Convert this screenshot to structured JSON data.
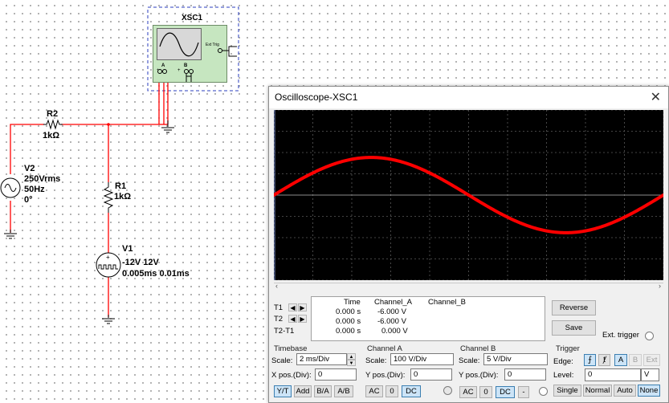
{
  "schematic": {
    "xsc1": {
      "label": "XSC1",
      "ext_trig": "Ext Trig",
      "port_a": "A",
      "port_b": "B",
      "plus": "+",
      "minus": "_"
    },
    "r2": {
      "name": "R2",
      "value": "1kΩ"
    },
    "r1": {
      "name": "R1",
      "value": "1kΩ"
    },
    "v2": {
      "name": "V2",
      "line1": "250Vrms",
      "line2": "50Hz",
      "line3": "0°"
    },
    "v1": {
      "name": "V1",
      "line1": "-12V 12V",
      "line2": "0.005ms 0.01ms"
    }
  },
  "oscilloscope": {
    "title": "Oscilloscope-XSC1",
    "readout": {
      "headers": [
        "Time",
        "Channel_A",
        "Channel_B"
      ],
      "rows": [
        {
          "label": "T1",
          "time": "0.000 s",
          "ch_a": "-6.000 V",
          "ch_b": ""
        },
        {
          "label": "T2",
          "time": "0.000 s",
          "ch_a": "-6.000 V",
          "ch_b": ""
        },
        {
          "label": "T2-T1",
          "time": "0.000 s",
          "ch_a": "0.000 V",
          "ch_b": ""
        }
      ]
    },
    "buttons": {
      "reverse": "Reverse",
      "save": "Save",
      "ext_trigger": "Ext. trigger"
    },
    "timebase": {
      "title": "Timebase",
      "scale_label": "Scale:",
      "scale_value": "2 ms/Div",
      "xpos_label": "X pos.(Div):",
      "xpos_value": "0",
      "modes": [
        "Y/T",
        "Add",
        "B/A",
        "A/B"
      ],
      "active_mode": "Y/T"
    },
    "channel_a": {
      "title": "Channel A",
      "scale_label": "Scale:",
      "scale_value": "100  V/Div",
      "ypos_label": "Y pos.(Div):",
      "ypos_value": "0",
      "coupling": [
        "AC",
        "0",
        "DC"
      ],
      "active_coupling": "DC"
    },
    "channel_b": {
      "title": "Channel B",
      "scale_label": "Scale:",
      "scale_value": "5  V/Div",
      "ypos_label": "Y pos.(Div):",
      "ypos_value": "0",
      "coupling": [
        "AC",
        "0",
        "DC",
        "-"
      ],
      "active_coupling": "DC"
    },
    "trigger": {
      "title": "Trigger",
      "edge_label": "Edge:",
      "sources": [
        "A",
        "B",
        "Ext"
      ],
      "active_source": "A",
      "level_label": "Level:",
      "level_value": "0",
      "level_unit": "V",
      "modes": [
        "Single",
        "Normal",
        "Auto",
        "None"
      ],
      "active_mode": "None"
    },
    "trace_color": "#ff0000",
    "chart_data": {
      "type": "line",
      "series": [
        {
          "name": "Channel_A",
          "color": "#ff0000",
          "function": "sine",
          "amplitude_div": 1.77,
          "period_div": 10,
          "phase_deg": 0
        }
      ],
      "xlim_div": [
        0,
        10
      ],
      "ylim_div": [
        -4,
        4
      ],
      "grid": true
    }
  }
}
